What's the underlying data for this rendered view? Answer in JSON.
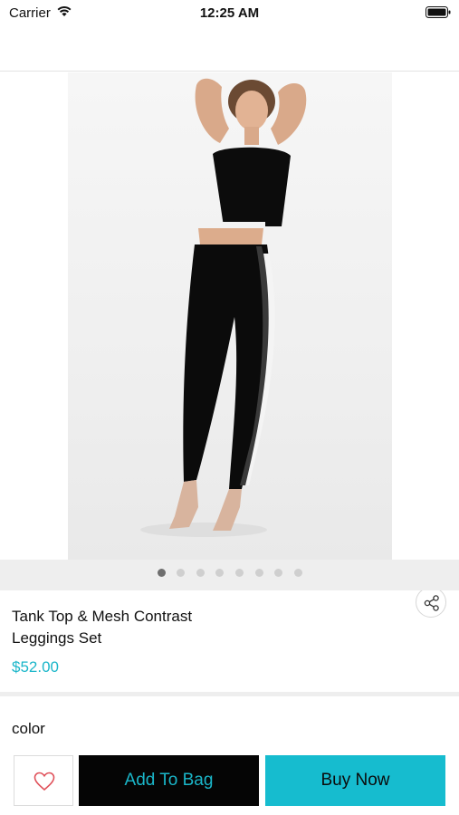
{
  "status_bar": {
    "carrier": "Carrier",
    "time": "12:25 AM",
    "icons": [
      "wifi-icon",
      "battery-icon"
    ]
  },
  "gallery": {
    "image": "product-photo",
    "page_count": 8,
    "active_page": 1,
    "share_icon": "share-icon"
  },
  "product": {
    "title": "Tank Top & Mesh Contrast Leggings Set",
    "price": "$52.00"
  },
  "options": {
    "color_label": "color"
  },
  "actions": {
    "wishlist_icon": "heart-icon",
    "add_to_bag_label": "Add To Bag",
    "buy_now_label": "Buy Now"
  },
  "colors": {
    "accent": "#16bccf",
    "price": "#1ab6c9",
    "add_to_bag_bg": "#050505",
    "heart": "#e0515a"
  }
}
